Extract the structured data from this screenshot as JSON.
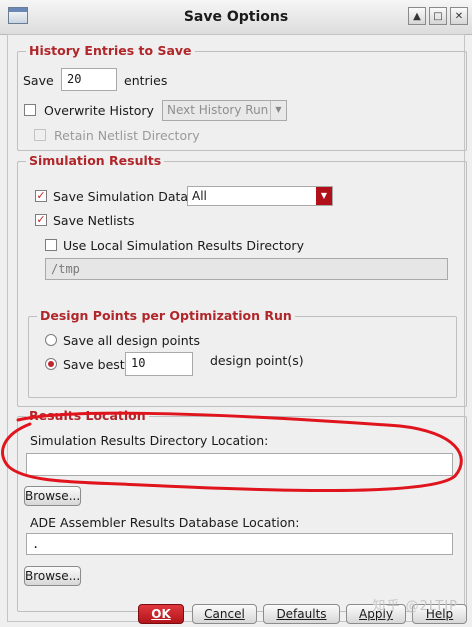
{
  "window": {
    "title": "Save Options"
  },
  "history": {
    "legend": "History Entries to Save",
    "save_label": "Save",
    "save_value": "20",
    "entries_label": "entries",
    "overwrite_label": "Overwrite History",
    "overwrite_checked": false,
    "next_history_option": "Next History Run",
    "retain_label": "Retain Netlist Directory"
  },
  "simulation": {
    "legend": "Simulation Results",
    "save_data_label": "Save Simulation Data",
    "save_data_checked": true,
    "save_data_option": "All",
    "save_netlists_label": "Save Netlists",
    "save_netlists_checked": true,
    "use_local_label": "Use Local Simulation Results Directory",
    "use_local_checked": false,
    "local_dir_value": "/tmp"
  },
  "design_points": {
    "legend": "Design Points per Optimization Run",
    "save_all_label": "Save all design points",
    "save_best_label": "Save best",
    "save_best_value": "10",
    "design_points_suffix": "design point(s)",
    "selected": "save_best"
  },
  "results_location": {
    "legend": "Results Location",
    "sim_dir_label": "Simulation Results Directory Location:",
    "sim_dir_value": "",
    "browse_label": "Browse...",
    "db_label": "ADE Assembler Results Database Location:",
    "db_value": ".",
    "browse2_label": "Browse..."
  },
  "buttons": {
    "ok": "OK",
    "cancel": "Cancel",
    "defaults": "Defaults",
    "apply": "Apply",
    "help": "Help"
  },
  "watermark": "知乎 @2LTIP",
  "colors": {
    "accent": "#b0262a",
    "annotation": "#e0141c"
  }
}
